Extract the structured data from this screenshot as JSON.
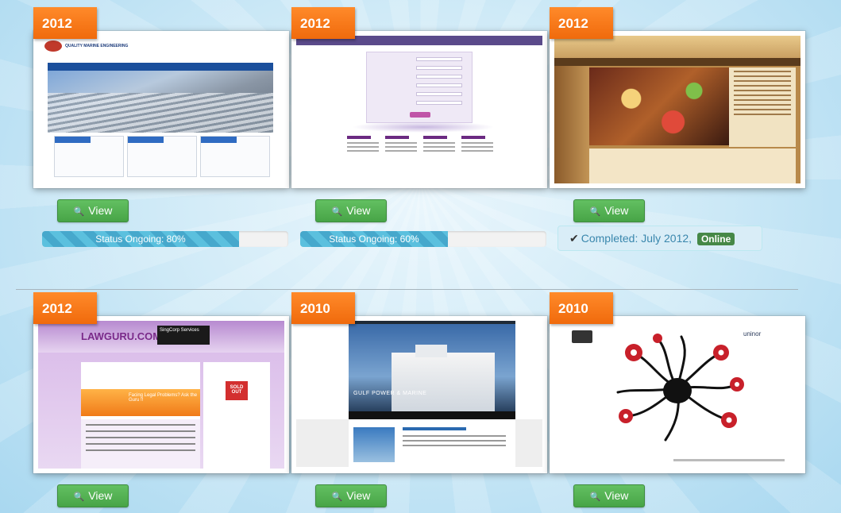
{
  "colors": {
    "year_badge": "#f47a1e",
    "view_button": "#5bb75b",
    "progress_bar": "#5bc0de",
    "completed_bg": "#d9edf7",
    "online_badge": "#468847"
  },
  "icons": {
    "view": "search-icon",
    "completed": "check-icon"
  },
  "projects": [
    {
      "year": "2012",
      "view_label": "View",
      "status_text": "Status Ongoing: 80%",
      "progress": 0.8,
      "thumb": {
        "logo": "QME",
        "tagline": "QUALITY MARINE ENGINEERING"
      }
    },
    {
      "year": "2012",
      "view_label": "View",
      "status_text": "Status Ongoing: 60%",
      "progress": 0.6
    },
    {
      "year": "2012",
      "view_label": "View",
      "completed_text": "Completed: July 2012,",
      "badge": "Online"
    },
    {
      "year": "2012",
      "view_label": "View",
      "thumb": {
        "logo": "LAWGURU.COM.SG",
        "banner": "SingCorp Services",
        "promo": "Facing Legal Problems? Ask the Guru !!",
        "sold": "SOLD OUT"
      }
    },
    {
      "year": "2010",
      "view_label": "View",
      "thumb": {
        "title": "GULF POWER & MARINE"
      }
    },
    {
      "year": "2010",
      "view_label": "View",
      "thumb": {
        "brand": "uninor"
      }
    }
  ]
}
